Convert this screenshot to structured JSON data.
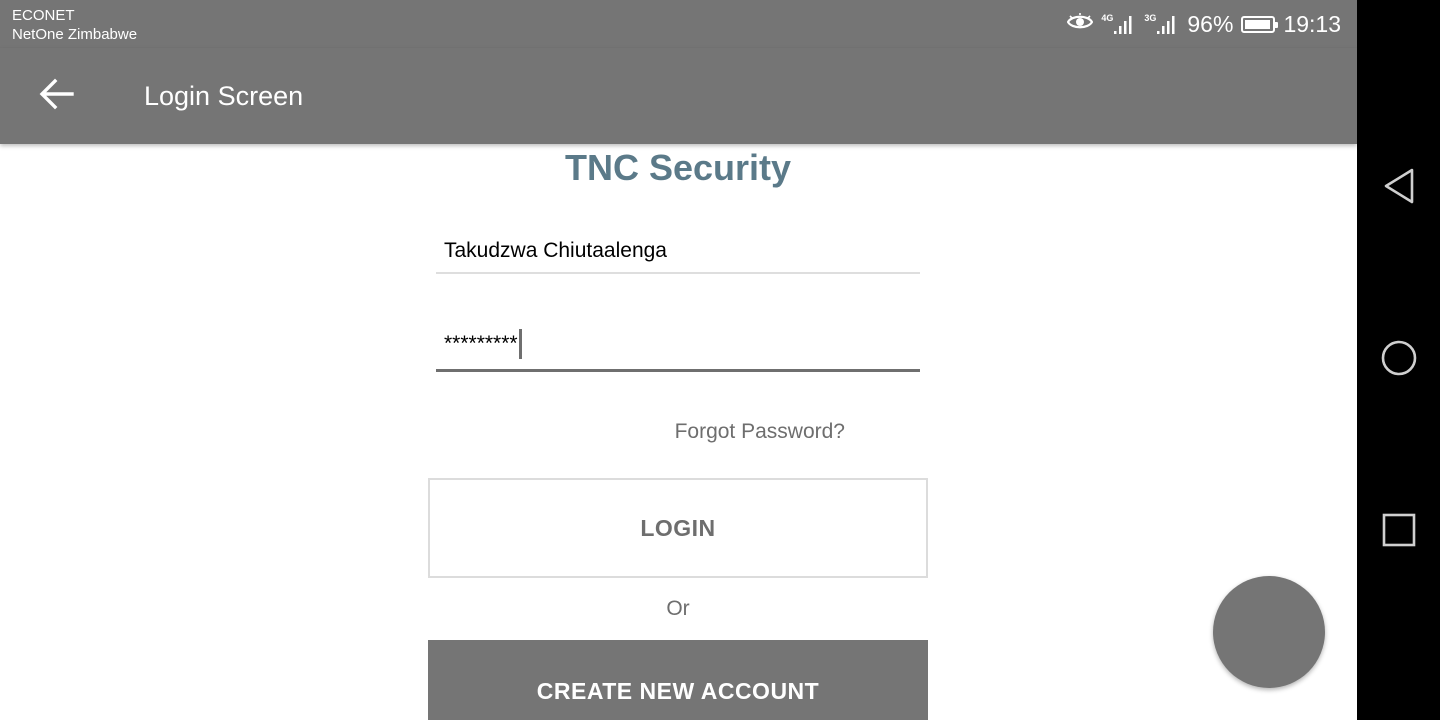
{
  "status_bar": {
    "carrier_primary": "ECONET",
    "carrier_secondary": "NetOne Zimbabwe",
    "network_1": "4G",
    "network_2": "3G",
    "battery_percent": "96%",
    "battery_level": 0.96,
    "time": "19:13",
    "icons": [
      "eye-icon",
      "signal-4g-icon",
      "signal-3g-icon",
      "battery-icon"
    ]
  },
  "app_bar": {
    "title": "Login Screen",
    "back_icon": "arrow-left-icon"
  },
  "login": {
    "brand": "TNC Security",
    "username_value": "Takudzwa Chiutaalenga",
    "password_value": "*********",
    "forgot_label": "Forgot Password?",
    "login_label": "LOGIN",
    "or_label": "Or",
    "create_label": "CREATE NEW ACCOUNT"
  },
  "nav_bar": {
    "icons": [
      "back-triangle-icon",
      "home-circle-icon",
      "recents-square-icon"
    ]
  },
  "colors": {
    "toolbar": "#757575",
    "brand_text": "#5b7a89",
    "nav_bar": "#000000",
    "muted_text": "#6e6e6e"
  }
}
